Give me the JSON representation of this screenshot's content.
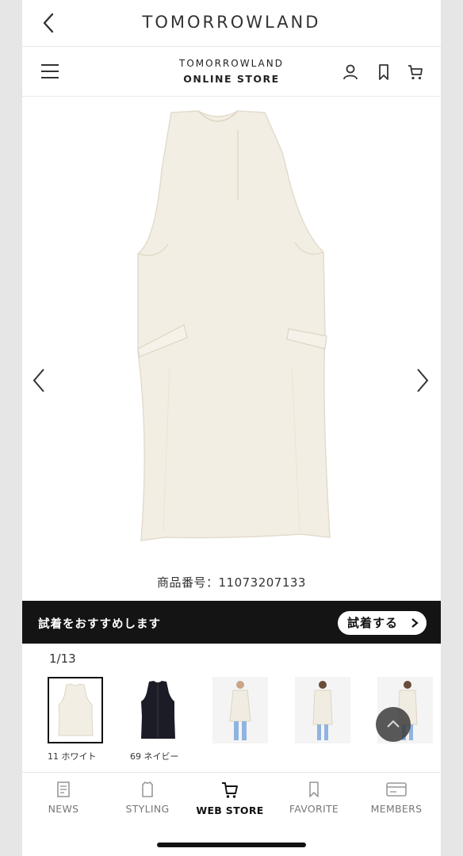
{
  "app": {
    "title": "TOMORROWLAND"
  },
  "store": {
    "brand_line1": "TOMORROWLAND",
    "brand_line2": "ONLINE STORE"
  },
  "product": {
    "code_label": "商品番号：11073207133"
  },
  "tryon": {
    "message": "試着をおすすめします",
    "button": "試着する"
  },
  "gallery": {
    "counter": "1/13",
    "thumbnails": [
      {
        "label": "11 ホワイト",
        "selected": true
      },
      {
        "label": "69 ネイビー",
        "selected": false
      },
      {
        "label": "",
        "selected": false
      },
      {
        "label": "",
        "selected": false
      },
      {
        "label": "",
        "selected": false
      }
    ]
  },
  "bottom_nav": {
    "items": [
      {
        "label": "NEWS",
        "icon": "news-icon"
      },
      {
        "label": "STYLING",
        "icon": "styling-icon"
      },
      {
        "label": "WEB STORE",
        "icon": "cart-icon",
        "active": true
      },
      {
        "label": "FAVORITE",
        "icon": "bookmark-icon"
      },
      {
        "label": "MEMBERS",
        "icon": "card-icon"
      }
    ]
  },
  "colors": {
    "banner_bg": "#141414",
    "accent_text": "#111111",
    "muted_text": "#777777"
  }
}
